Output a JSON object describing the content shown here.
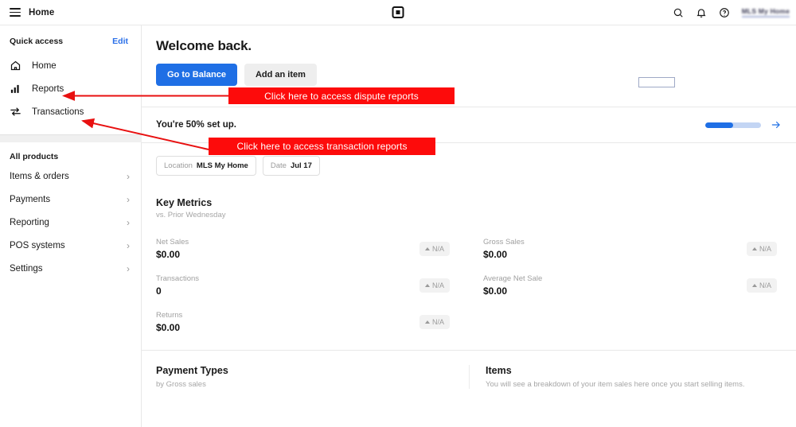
{
  "topbar": {
    "menu_icon": "hamburger-icon",
    "home_label": "Home",
    "logo": "square-logo",
    "search_icon": "search-icon",
    "notification_icon": "bell-icon",
    "help_icon": "help-circle-icon",
    "account_name": "MLS My Home"
  },
  "sidebar": {
    "quick_access_title": "Quick access",
    "edit_label": "Edit",
    "quick_items": [
      {
        "label": "Home",
        "icon": "home-icon"
      },
      {
        "label": "Reports",
        "icon": "bar-chart-icon"
      },
      {
        "label": "Transactions",
        "icon": "transfer-arrows-icon"
      }
    ],
    "all_products_title": "All products",
    "product_items": [
      {
        "label": "Items & orders",
        "icon": "chevron-right-icon"
      },
      {
        "label": "Payments",
        "icon": "chevron-right-icon"
      },
      {
        "label": "Reporting",
        "icon": "chevron-right-icon"
      },
      {
        "label": "POS systems",
        "icon": "chevron-right-icon"
      },
      {
        "label": "Settings",
        "icon": "chevron-right-icon"
      }
    ]
  },
  "main": {
    "welcome_title": "Welcome back.",
    "primary_button": "Go to Balance",
    "secondary_button": "Add an item",
    "setup_text": "You're 50% set up.",
    "setup_progress": 50,
    "setup_arrow_icon": "arrow-right-icon",
    "filters": [
      {
        "key": "Location",
        "value": "MLS My Home"
      },
      {
        "key": "Date",
        "value": "Jul 17"
      }
    ],
    "key_metrics": {
      "title": "Key Metrics",
      "subtitle": "vs. Prior Wednesday",
      "metrics": [
        {
          "label": "Net Sales",
          "value": "$0.00",
          "badge": "N/A"
        },
        {
          "label": "Gross Sales",
          "value": "$0.00",
          "badge": "N/A"
        },
        {
          "label": "Transactions",
          "value": "0",
          "badge": "N/A"
        },
        {
          "label": "Average Net Sale",
          "value": "$0.00",
          "badge": "N/A"
        },
        {
          "label": "Returns",
          "value": "$0.00",
          "badge": "N/A"
        }
      ]
    },
    "payment_types": {
      "title": "Payment Types",
      "subtitle": "by Gross sales"
    },
    "items_panel": {
      "title": "Items",
      "subtitle": "You will see a breakdown of your item sales here once you start selling items."
    }
  },
  "annotations": {
    "dispute": "Click here to access dispute reports",
    "transaction": "Click here to access transaction reports",
    "color": "#fd0b0b"
  }
}
